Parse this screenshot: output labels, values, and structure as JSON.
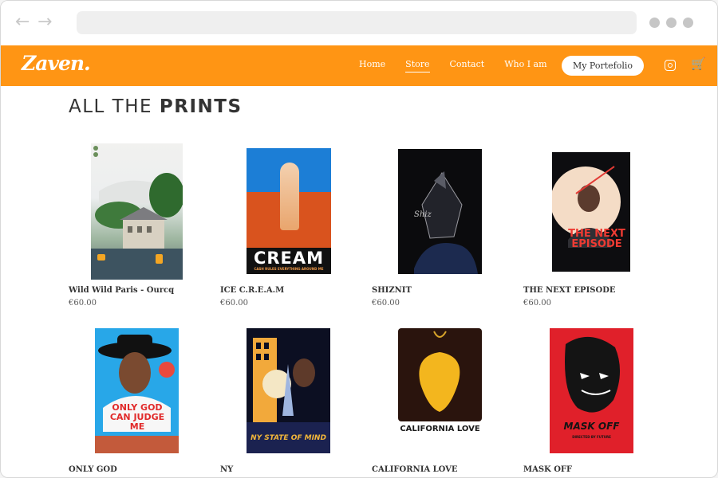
{
  "brand": {
    "logo": "Zaven."
  },
  "nav": {
    "items": [
      "Home",
      "Store",
      "Contact",
      "Who I am"
    ],
    "active": "Store",
    "portfolio_button": "My Portefolio"
  },
  "icons": {
    "back": "back-arrow-icon",
    "forward": "forward-arrow-icon",
    "instagram": "instagram-icon",
    "cart": "cart-icon"
  },
  "colors": {
    "accent": "#ff9514"
  },
  "heading": {
    "light": "ALL THE",
    "bold": "PRINTS"
  },
  "posters": {
    "cream": "CREAM",
    "cream_sub": "CASH RULES EVERYTHING AROUND ME",
    "next": "THE NEXT EPISODE",
    "ocjm": "ONLY GOD CAN JUDGE ME",
    "nysom": "NY STATE OF MIND",
    "cali": "CALIFORNIA LOVE",
    "mask": "MASK OFF",
    "mask_dir": "DIRECTED BY FUTURE"
  },
  "products": [
    {
      "name": "Wild Wild Paris - Ourcq",
      "price": "€60.00"
    },
    {
      "name": "ICE C.R.E.A.M",
      "price": "€60.00"
    },
    {
      "name": "SHIZNIT",
      "price": "€60.00"
    },
    {
      "name": "THE NEXT EPISODE",
      "price": "€60.00"
    },
    {
      "name": "ONLY GOD"
    },
    {
      "name": "NY"
    },
    {
      "name": "CALIFORNIA LOVE"
    },
    {
      "name": "MASK OFF"
    }
  ]
}
